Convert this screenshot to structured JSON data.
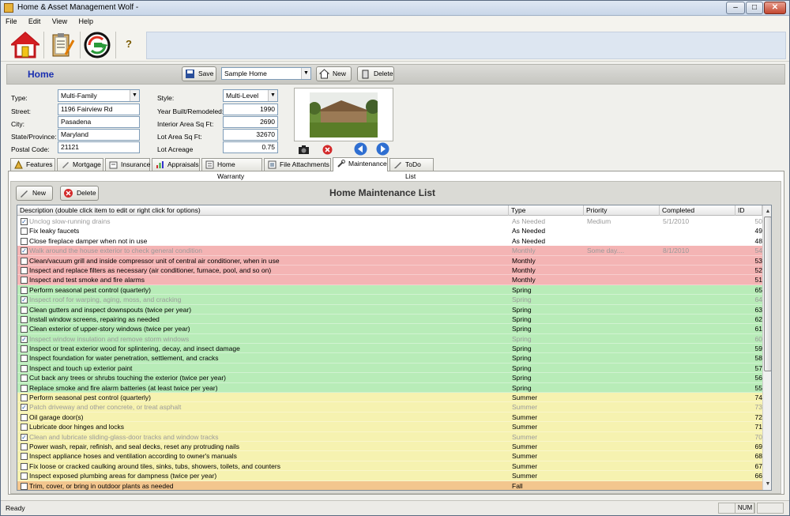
{
  "window": {
    "title": "Home & Asset Management Wolf -"
  },
  "menu": [
    "File",
    "Edit",
    "View",
    "Help"
  ],
  "toolbar": {
    "help_label": "?"
  },
  "home": {
    "title": "Home",
    "save_label": "Save",
    "home_select": "Sample Home",
    "new_label": "New",
    "delete_label": "Delete"
  },
  "form": {
    "type_label": "Type:",
    "type_value": "Multi-Family",
    "street_label": "Street:",
    "street_value": "1196 Fairview Rd",
    "city_label": "City:",
    "city_value": "Pasadena",
    "state_label": "State/Province:",
    "state_value": "Maryland",
    "postal_label": "Postal Code:",
    "postal_value": "21121",
    "style_label": "Style:",
    "style_value": "Multi-Level",
    "year_label": "Year Built/Remodeled:",
    "year_value": "1990",
    "interior_label": "Interior Area Sq Ft:",
    "interior_value": "2690",
    "lot_label": "Lot Area Sq Ft:",
    "lot_value": "32670",
    "acreage_label": "Lot Acreage",
    "acreage_value": "0.75"
  },
  "tabs": [
    "Features",
    "Mortgage",
    "Insurance",
    "Appraisals",
    "Home Warranty",
    "File Attachments",
    "Maintenance",
    "ToDo List"
  ],
  "maintenance": {
    "new_label": "New",
    "delete_label": "Delete",
    "title": "Home Maintenance List",
    "columns": [
      "Description (double click item to edit or right click for options)",
      "Type",
      "Priority",
      "Completed",
      "ID"
    ],
    "rows": [
      {
        "checked": true,
        "desc": "Unclog slow-running drains",
        "type": "As Needed",
        "priority": "Medium",
        "completed": "5/1/2010",
        "id": "50",
        "color": "#ffffff"
      },
      {
        "checked": false,
        "desc": "Fix leaky faucets",
        "type": "As Needed",
        "priority": "",
        "completed": "",
        "id": "49",
        "color": "#ffffff"
      },
      {
        "checked": false,
        "desc": "Close fireplace damper when not in use",
        "type": "As Needed",
        "priority": "",
        "completed": "",
        "id": "48",
        "color": "#ffffff"
      },
      {
        "checked": true,
        "desc": "Walk around the house exterior to check general condition",
        "type": "Monthly",
        "priority": "Some day....",
        "completed": "8/1/2010",
        "id": "54",
        "color": "#f4b4b4"
      },
      {
        "checked": false,
        "desc": "Clean/vacuum grill and inside compressor unit of central air conditioner, when in use",
        "type": "Monthly",
        "priority": "",
        "completed": "",
        "id": "53",
        "color": "#f4b4b4"
      },
      {
        "checked": false,
        "desc": "Inspect and replace filters as necessary (air conditioner, furnace, pool, and so on)",
        "type": "Monthly",
        "priority": "",
        "completed": "",
        "id": "52",
        "color": "#f4b4b4"
      },
      {
        "checked": false,
        "desc": "Inspect and test smoke and fire alarms",
        "type": "Monthly",
        "priority": "",
        "completed": "",
        "id": "51",
        "color": "#f4b4b4"
      },
      {
        "checked": false,
        "desc": "Perform seasonal pest control (quarterly)",
        "type": "Spring",
        "priority": "",
        "completed": "",
        "id": "65",
        "color": "#b8ecb8"
      },
      {
        "checked": true,
        "desc": "Inspect roof for warping, aging, moss, and cracking",
        "type": "Spring",
        "priority": "",
        "completed": "",
        "id": "64",
        "color": "#b8ecb8"
      },
      {
        "checked": false,
        "desc": "Clean gutters and inspect downspouts (twice per year)",
        "type": "Spring",
        "priority": "",
        "completed": "",
        "id": "63",
        "color": "#b8ecb8"
      },
      {
        "checked": false,
        "desc": "Install window screens, repairing as needed",
        "type": "Spring",
        "priority": "",
        "completed": "",
        "id": "62",
        "color": "#b8ecb8"
      },
      {
        "checked": false,
        "desc": "Clean exterior of upper-story windows (twice per year)",
        "type": "Spring",
        "priority": "",
        "completed": "",
        "id": "61",
        "color": "#b8ecb8"
      },
      {
        "checked": true,
        "desc": "Inspect window insulation and remove storm windows",
        "type": "Spring",
        "priority": "",
        "completed": "",
        "id": "60",
        "color": "#b8ecb8"
      },
      {
        "checked": false,
        "desc": "Inspect or treat exterior wood for splintering, decay, and insect damage",
        "type": "Spring",
        "priority": "",
        "completed": "",
        "id": "59",
        "color": "#b8ecb8"
      },
      {
        "checked": false,
        "desc": "Inspect foundation for water penetration, settlement, and cracks",
        "type": "Spring",
        "priority": "",
        "completed": "",
        "id": "58",
        "color": "#b8ecb8"
      },
      {
        "checked": false,
        "desc": "Inspect and touch up exterior paint",
        "type": "Spring",
        "priority": "",
        "completed": "",
        "id": "57",
        "color": "#b8ecb8"
      },
      {
        "checked": false,
        "desc": "Cut back any trees or shrubs touching the exterior (twice per year)",
        "type": "Spring",
        "priority": "",
        "completed": "",
        "id": "56",
        "color": "#b8ecb8"
      },
      {
        "checked": false,
        "desc": "Replace smoke and fire alarm batteries (at least twice per year)",
        "type": "Spring",
        "priority": "",
        "completed": "",
        "id": "55",
        "color": "#b8ecb8"
      },
      {
        "checked": false,
        "desc": "Perform seasonal pest control (quarterly)",
        "type": "Summer",
        "priority": "",
        "completed": "",
        "id": "74",
        "color": "#f6f2b0"
      },
      {
        "checked": true,
        "desc": "Patch driveway and other concrete, or treat asphalt",
        "type": "Summer",
        "priority": "",
        "completed": "",
        "id": "73",
        "color": "#f6f2b0"
      },
      {
        "checked": false,
        "desc": "Oil garage door(s)",
        "type": "Summer",
        "priority": "",
        "completed": "",
        "id": "72",
        "color": "#f6f2b0"
      },
      {
        "checked": false,
        "desc": "Lubricate door hinges and locks",
        "type": "Summer",
        "priority": "",
        "completed": "",
        "id": "71",
        "color": "#f6f2b0"
      },
      {
        "checked": true,
        "desc": "Clean and lubricate sliding-glass-door tracks and window tracks",
        "type": "Summer",
        "priority": "",
        "completed": "",
        "id": "70",
        "color": "#f6f2b0"
      },
      {
        "checked": false,
        "desc": "Power wash, repair, refinish, and seal decks, reset any protruding nails",
        "type": "Summer",
        "priority": "",
        "completed": "",
        "id": "69",
        "color": "#f6f2b0"
      },
      {
        "checked": false,
        "desc": "Inspect appliance hoses and ventilation according to owner's manuals",
        "type": "Summer",
        "priority": "",
        "completed": "",
        "id": "68",
        "color": "#f6f2b0"
      },
      {
        "checked": false,
        "desc": "Fix loose or cracked caulking around tiles, sinks, tubs, showers, toilets, and counters",
        "type": "Summer",
        "priority": "",
        "completed": "",
        "id": "67",
        "color": "#f6f2b0"
      },
      {
        "checked": false,
        "desc": "Inspect exposed plumbing areas for dampness (twice per year)",
        "type": "Summer",
        "priority": "",
        "completed": "",
        "id": "66",
        "color": "#f6f2b0"
      },
      {
        "checked": false,
        "desc": "Trim, cover, or bring in outdoor plants as needed",
        "type": "Fall",
        "priority": "",
        "completed": "",
        "id": "",
        "color": "#f3c68e"
      }
    ]
  },
  "status": {
    "text": "Ready",
    "num": "NUM"
  }
}
